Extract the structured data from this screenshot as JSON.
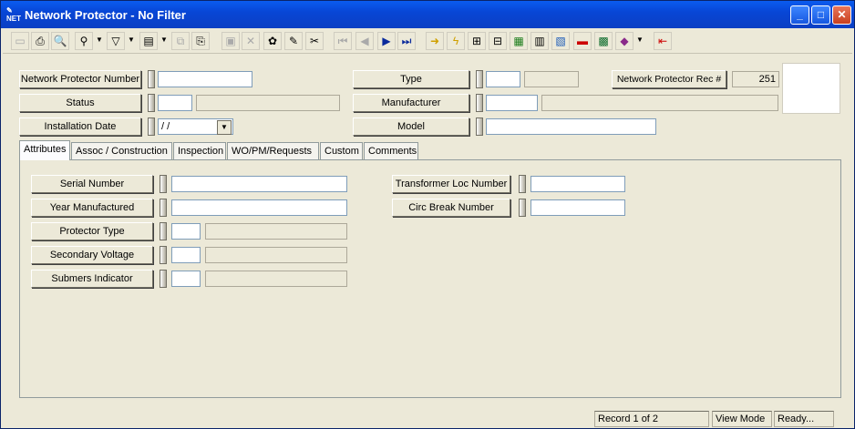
{
  "window": {
    "title": "Network Protector - No Filter",
    "app_icon_text": "NET"
  },
  "titlebar_buttons": {
    "minimize": "_",
    "maximize": "□",
    "close": "✕"
  },
  "toolbar": {
    "icons": [
      "new-icon",
      "print-icon",
      "print-preview-icon",
      "find-icon",
      "filter-icon",
      "report-icon",
      "copy-icon",
      "paste-icon",
      "save-icon",
      "delete-icon",
      "spell-icon",
      "edit-icon",
      "cut-icon",
      "first-record-icon",
      "prev-record-icon",
      "next-record-icon",
      "last-record-icon",
      "goto-icon",
      "lightning-icon",
      "tree-icon",
      "hierarchy-icon",
      "map-icon",
      "calculator-icon",
      "image-icon",
      "vehicle-icon",
      "spreadsheet-icon",
      "book-icon",
      "exit-icon"
    ]
  },
  "header": {
    "network_protector_number": {
      "label": "Network Protector Number",
      "value": ""
    },
    "status": {
      "label": "Status",
      "code": "",
      "desc": ""
    },
    "installation_date": {
      "label": "Installation Date",
      "value": " /  /"
    },
    "type": {
      "label": "Type",
      "code": "",
      "desc": ""
    },
    "manufacturer": {
      "label": "Manufacturer",
      "code": "",
      "desc": ""
    },
    "model": {
      "label": "Model",
      "value": ""
    },
    "rec_number": {
      "label": "Network Protector Rec #",
      "value": "251"
    }
  },
  "tabs": [
    "Attributes",
    "Assoc / Construction",
    "Inspection",
    "WO/PM/Requests",
    "Custom",
    "Comments"
  ],
  "attributes": {
    "serial_number": {
      "label": "Serial Number",
      "value": ""
    },
    "year_manufactured": {
      "label": "Year Manufactured",
      "value": ""
    },
    "protector_type": {
      "label": "Protector Type",
      "code": "",
      "desc": ""
    },
    "secondary_voltage": {
      "label": "Secondary Voltage",
      "code": "",
      "desc": ""
    },
    "submers_indicator": {
      "label": "Submers Indicator",
      "code": "",
      "desc": ""
    },
    "transformer_loc_number": {
      "label": "Transformer Loc Number",
      "value": ""
    },
    "circ_break_number": {
      "label": "Circ Break Number",
      "value": ""
    }
  },
  "statusbar": {
    "record": "Record 1 of 2",
    "mode": "View Mode",
    "state": "Ready..."
  }
}
